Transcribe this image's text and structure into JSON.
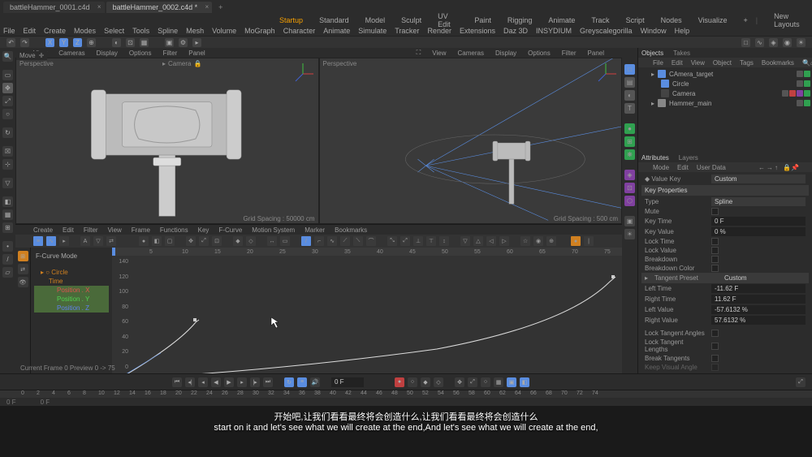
{
  "titlebar": {
    "tab1": "battleHammer_0001.c4d",
    "tab2": "battleHammer_0002.c4d *"
  },
  "menu": {
    "file": "File",
    "edit": "Edit",
    "create": "Create",
    "modes": "Modes",
    "select": "Select",
    "tools": "Tools",
    "spline": "Spline",
    "mesh": "Mesh",
    "volume": "Volume",
    "mograph": "MoGraph",
    "character": "Character",
    "animate": "Animate",
    "simulate": "Simulate",
    "tracker": "Tracker",
    "render": "Render",
    "extensions": "Extensions",
    "daz3d": "Daz 3D",
    "insydium": "INSYDIUM",
    "greyscale": "Greyscalegorilla",
    "window": "Window",
    "help": "Help",
    "startup": "Startup",
    "standard": "Standard",
    "model": "Model",
    "sculpt": "Sculpt",
    "uvedit": "UV Edit",
    "paint": "Paint",
    "rigging": "Rigging",
    "animate2": "Animate",
    "track": "Track",
    "script": "Script",
    "nodes": "Nodes",
    "visualize": "Visualize",
    "newlayouts": "New Layouts"
  },
  "submenu1": {
    "view": "View",
    "cameras": "Cameras",
    "display": "Display",
    "options": "Options",
    "filter": "Filter",
    "panel": "Panel"
  },
  "viewport": {
    "perspective": "Perspective",
    "camera": "Camera",
    "grid1": "Grid Spacing : 50000 cm",
    "grid2": "Grid Spacing : 500 cm",
    "move": "Move"
  },
  "curve": {
    "create": "Create",
    "edit": "Edit",
    "filter": "Filter",
    "view": "View",
    "frame": "Frame",
    "functions": "Functions",
    "key": "Key",
    "fcurve": "F-Curve",
    "motionsys": "Motion System",
    "marker": "Marker",
    "bookmarks": "Bookmarks",
    "mode": "F-Curve Mode",
    "circle": "Circle",
    "time": "Time",
    "posx": "Position . X",
    "posy": "Position . Y",
    "posz": "Position . Z",
    "info": "Current Frame  0  Preview  0 -> 75",
    "ticks": [
      "5",
      "10",
      "15",
      "20",
      "25",
      "30",
      "35",
      "40",
      "45",
      "50",
      "55",
      "60",
      "65",
      "70",
      "75"
    ],
    "yticks": [
      "140",
      "120",
      "100",
      "80",
      "60",
      "40",
      "20",
      "0"
    ]
  },
  "objects": {
    "tab1": "Objects",
    "tab2": "Takes",
    "file": "File",
    "edit": "Edit",
    "view": "View",
    "object": "Object",
    "tags": "Tags",
    "bookmarks": "Bookmarks",
    "cam_target": "CAmera_target",
    "circle": "Circle",
    "camera": "Camera",
    "hammer": "Hammer_main"
  },
  "attrs": {
    "tab1": "Attributes",
    "tab2": "Layers",
    "mode": "Mode",
    "edit": "Edit",
    "userdata": "User Data",
    "valuekey": "Value Key",
    "custom": "Custom",
    "keyprops": "Key Properties",
    "type": "Type",
    "spline": "Spline",
    "mute": "Mute",
    "keytime": "Key Time",
    "keytime_v": "0 F",
    "keyvalue": "Key Value",
    "keyvalue_v": "0 %",
    "locktime": "Lock Time",
    "lockvalue": "Lock Value",
    "breakdown": "Breakdown",
    "breakcolor": "Breakdown Color",
    "tangentpreset": "Tangent Preset",
    "tpreset_v": "Custom",
    "lefttime": "Left Time",
    "lefttime_v": "-11.62 F",
    "righttime": "Right Time",
    "righttime_v": "11.62 F",
    "leftval": "Left Value",
    "leftval_v": "-57.6132 %",
    "rightval": "Right Value",
    "rightval_v": "57.6132 %",
    "locktanang": "Lock Tangent Angles",
    "locktanlen": "Lock Tangent Lengths",
    "breaktan": "Break Tangents",
    "keepvisang": "Keep Visual Angle"
  },
  "timeline": {
    "frame": "0 F",
    "ticks": [
      "0",
      "2",
      "4",
      "6",
      "8",
      "10",
      "12",
      "14",
      "16",
      "18",
      "20",
      "22",
      "24",
      "26",
      "28",
      "30",
      "32",
      "34",
      "36",
      "38",
      "40",
      "42",
      "44",
      "46",
      "48",
      "50",
      "52",
      "54",
      "56",
      "58",
      "60",
      "62",
      "64",
      "66",
      "68",
      "70",
      "72",
      "74"
    ],
    "start": "0 F",
    "end": "0 F"
  },
  "subtitle": {
    "cn": "开始吧,让我们看看最终将会创造什么,让我们看看最终将会创造什么",
    "en": "start on it and let's see what we will create at the end,And let's see what we will create at the end,"
  }
}
